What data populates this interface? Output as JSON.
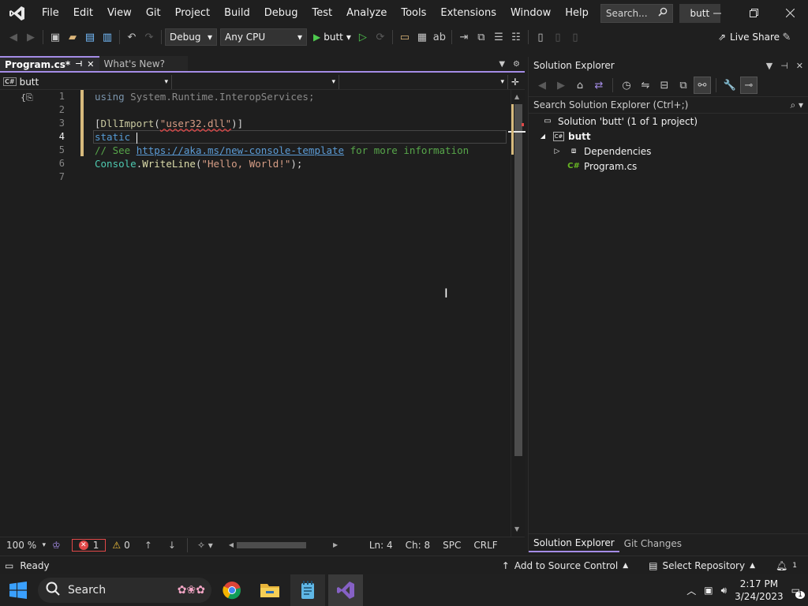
{
  "menu": {
    "items": [
      "File",
      "Edit",
      "View",
      "Git",
      "Project",
      "Build",
      "Debug",
      "Test",
      "Analyze",
      "Tools",
      "Extensions",
      "Window",
      "Help"
    ],
    "search_placeholder": "Search...",
    "solution_name": "butt"
  },
  "toolbar": {
    "config": "Debug",
    "platform": "Any CPU",
    "run_target": "butt",
    "live_share": "Live Share"
  },
  "tabs": [
    {
      "label": "Program.cs*",
      "active": true
    },
    {
      "label": "What's New?",
      "active": false
    }
  ],
  "navbar": {
    "project": "butt",
    "member": "",
    "member2": ""
  },
  "editor": {
    "lines": [
      {
        "num": "1",
        "text": "using System.Runtime.InteropServices;"
      },
      {
        "num": "2",
        "text": ""
      },
      {
        "num": "3",
        "text": "[DllImport(\"user32.dll\")]"
      },
      {
        "num": "4",
        "text": "static "
      },
      {
        "num": "5",
        "text": "// See https://aka.ms/new-console-template for more information"
      },
      {
        "num": "6",
        "text": "Console.WriteLine(\"Hello, World!\");"
      },
      {
        "num": "7",
        "text": ""
      }
    ],
    "current_line": 4
  },
  "editor_status": {
    "zoom": "100 %",
    "errors": "1",
    "warnings": "0",
    "line": "Ln: 4",
    "col": "Ch: 8",
    "whitespace": "SPC",
    "eol": "CRLF"
  },
  "solution_explorer": {
    "title": "Solution Explorer",
    "search_placeholder": "Search Solution Explorer (Ctrl+;)",
    "solution_label": "Solution 'butt' (1 of 1 project)",
    "project": "butt",
    "dependencies": "Dependencies",
    "file": "Program.cs",
    "bottom_tabs": [
      "Solution Explorer",
      "Git Changes"
    ]
  },
  "statusbar": {
    "ready": "Ready",
    "source_control": "Add to Source Control",
    "repository": "Select Repository",
    "notifications": "1"
  },
  "taskbar": {
    "search": "Search",
    "time": "2:17 PM",
    "date": "3/24/2023",
    "notification_count": "1"
  },
  "colors": {
    "accent": "#a48ce6",
    "vs_purple": "#8661c5",
    "error": "#e04848"
  }
}
